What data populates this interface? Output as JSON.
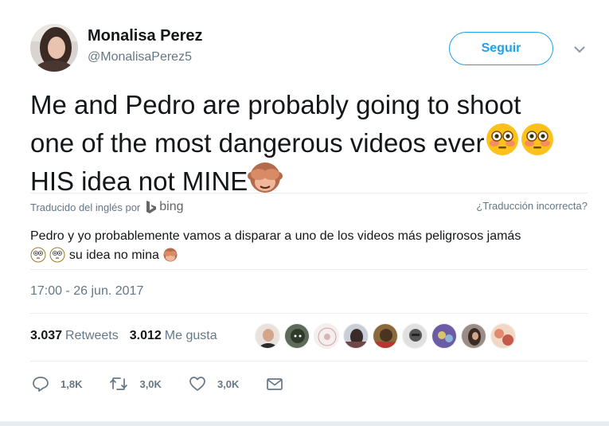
{
  "user": {
    "name": "Monalisa Perez",
    "handle": "@MonalisaPerez5"
  },
  "follow_button": "Seguir",
  "tweet": {
    "line1": "Me and Pedro are probably going to shoot",
    "line2": "one of the most dangerous videos ever",
    "line3": "HIS idea not MINE"
  },
  "translation": {
    "translated_by": "Traducido del inglés por",
    "provider": "bing",
    "wrong_translation": "¿Traducción incorrecta?",
    "text_line1": "Pedro y yo probablemente vamos a disparar a uno de los videos más peligrosos jamás",
    "text_line2": "su idea no mina"
  },
  "timestamp": "17:00 - 26 jun. 2017",
  "stats": {
    "retweets_count": "3.037",
    "retweets_label": "Retweets",
    "likes_count": "3.012",
    "likes_label": "Me gusta"
  },
  "actions": {
    "reply_count": "1,8K",
    "retweet_count": "3,0K",
    "like_count": "3,0K"
  },
  "colors": {
    "accent": "#1da1f2",
    "secondary_text": "#657786",
    "divider": "#e6ecf0"
  },
  "icons": [
    "chevron-down-icon",
    "flushed-face-icon",
    "see-no-evil-monkey-icon",
    "bing-logo-icon",
    "reply-icon",
    "retweet-icon",
    "heart-icon",
    "dm-envelope-icon"
  ]
}
